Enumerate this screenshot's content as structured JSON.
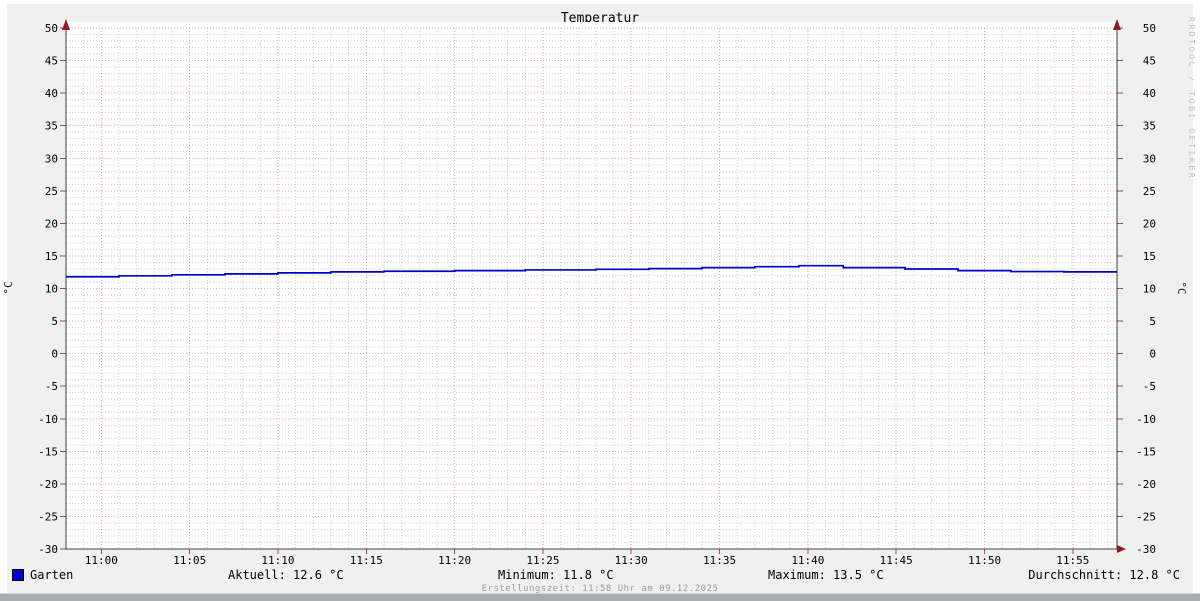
{
  "title": "Temperatur",
  "watermark": "RRDTOOL / TOBI OETIKER",
  "y_axis_label_left": "°C",
  "y_axis_label_right": "°C",
  "legend": {
    "label": "Garten",
    "color": "#0000c8"
  },
  "stats": {
    "aktuell": "Aktuell: 12.6 °C",
    "minimum": "Minimum: 11.8 °C",
    "maximum": "Maximum: 13.5 °C",
    "durchschnitt": "Durchschnitt: 12.8 °C"
  },
  "footer": "Erstellungszeit: 11:58 Uhr am 09.12.2025",
  "chart_data": {
    "type": "line",
    "title": "Temperatur",
    "xlabel": "",
    "ylabel": "°C",
    "x_axis": {
      "description": "minutes relative to 11:00, plot spans 10:58 to 11:57:30",
      "min": -2,
      "max": 57.5,
      "major_tick_minutes": 5,
      "minor_tick_minutes": 1,
      "tick_positions": [
        0,
        5,
        10,
        15,
        20,
        25,
        30,
        35,
        40,
        45,
        50,
        55
      ],
      "tick_labels": [
        "11:00",
        "11:05",
        "11:10",
        "11:15",
        "11:20",
        "11:25",
        "11:30",
        "11:35",
        "11:40",
        "11:45",
        "11:50",
        "11:55"
      ]
    },
    "y_axis": {
      "min": -30,
      "max": 50,
      "major_tick": 5,
      "minor_tick": 1,
      "tick_labels": [
        "50",
        "45",
        "40",
        "35",
        "30",
        "25",
        "20",
        "15",
        "10",
        "5",
        "0",
        "-5",
        "-10",
        "-15",
        "-20",
        "-25",
        "-30"
      ]
    },
    "grid": {
      "major_color": "rgba(210,60,60,0.45)",
      "minor_color": "rgba(100,100,100,0.28)",
      "axis_color": "#404040",
      "arrow_color": "#8a1f1f"
    },
    "series": [
      {
        "name": "Garten",
        "color": "#0000c8",
        "step": true,
        "points": [
          [
            -2,
            11.8
          ],
          [
            1,
            11.95
          ],
          [
            4,
            12.1
          ],
          [
            7,
            12.25
          ],
          [
            10,
            12.4
          ],
          [
            13,
            12.55
          ],
          [
            16,
            12.65
          ],
          [
            20,
            12.75
          ],
          [
            24,
            12.85
          ],
          [
            28,
            12.95
          ],
          [
            31,
            13.05
          ],
          [
            34,
            13.2
          ],
          [
            37,
            13.35
          ],
          [
            39.5,
            13.5
          ],
          [
            42,
            13.2
          ],
          [
            45.5,
            13.0
          ],
          [
            48.5,
            12.75
          ],
          [
            51.5,
            12.6
          ],
          [
            54.5,
            12.55
          ]
        ]
      }
    ],
    "summary": {
      "aktuell_c": 12.6,
      "minimum_c": 11.8,
      "maximum_c": 13.5,
      "durchschnitt_c": 12.8
    }
  }
}
